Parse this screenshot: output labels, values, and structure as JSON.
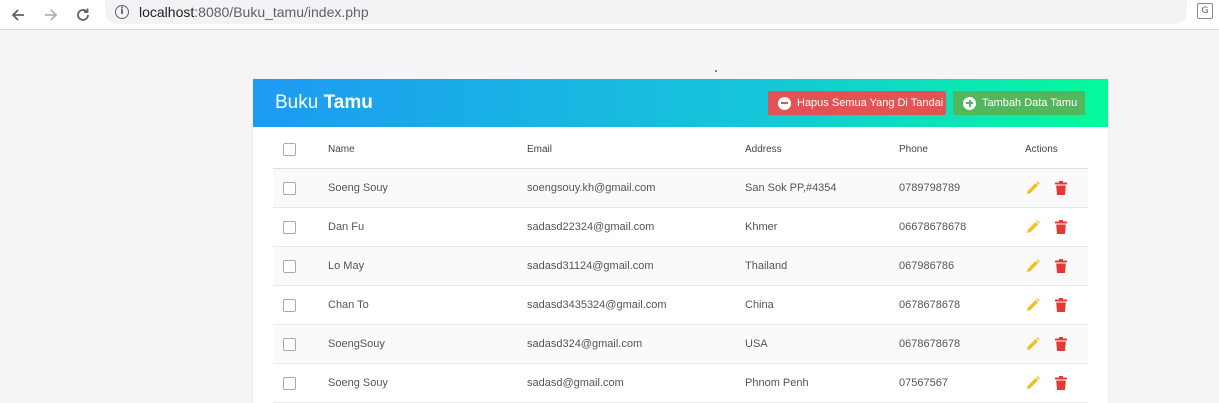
{
  "browser": {
    "url_host": "localhost",
    "url_path": ":8080/Buku_tamu/index.php",
    "info_glyph": "i",
    "translate_glyph": "G"
  },
  "header": {
    "title_light": "Buku ",
    "title_bold": "Tamu",
    "delete_label": "Hapus Semua Yang Di Tandai",
    "add_label": "Tambah Data Tamu"
  },
  "table": {
    "columns": [
      "Name",
      "Email",
      "Address",
      "Phone",
      "Actions"
    ],
    "rows": [
      {
        "name": "Soeng Souy",
        "email": "soengsouy.kh@gmail.com",
        "address": "San Sok PP,#4354",
        "phone": "0789798789"
      },
      {
        "name": "Dan Fu",
        "email": "sadasd22324@gmail.com",
        "address": "Khmer",
        "phone": "06678678678"
      },
      {
        "name": "Lo May",
        "email": "sadasd31124@gmail.com",
        "address": "Thailand",
        "phone": "067986786"
      },
      {
        "name": "Chan To",
        "email": "sadasd3435324@gmail.com",
        "address": "China",
        "phone": "0678678678"
      },
      {
        "name": "SoengSouy",
        "email": "sadasd324@gmail.com",
        "address": "USA",
        "phone": "0678678678"
      },
      {
        "name": "Soeng Souy",
        "email": "sadasd@gmail.com",
        "address": "Phnom Penh",
        "phone": "07567567"
      }
    ]
  },
  "colors": {
    "header_gradient_start": "#1e9af2",
    "header_gradient_end": "#05fb9a",
    "delete_button": "#e35354",
    "add_button": "#54b65a",
    "edit_icon": "#f5bd1f",
    "delete_icon": "#e53935"
  },
  "icons": {
    "edit": "pencil-icon",
    "delete": "trash-icon",
    "delete_all": "minus-circle-icon",
    "add": "plus-circle-icon"
  }
}
